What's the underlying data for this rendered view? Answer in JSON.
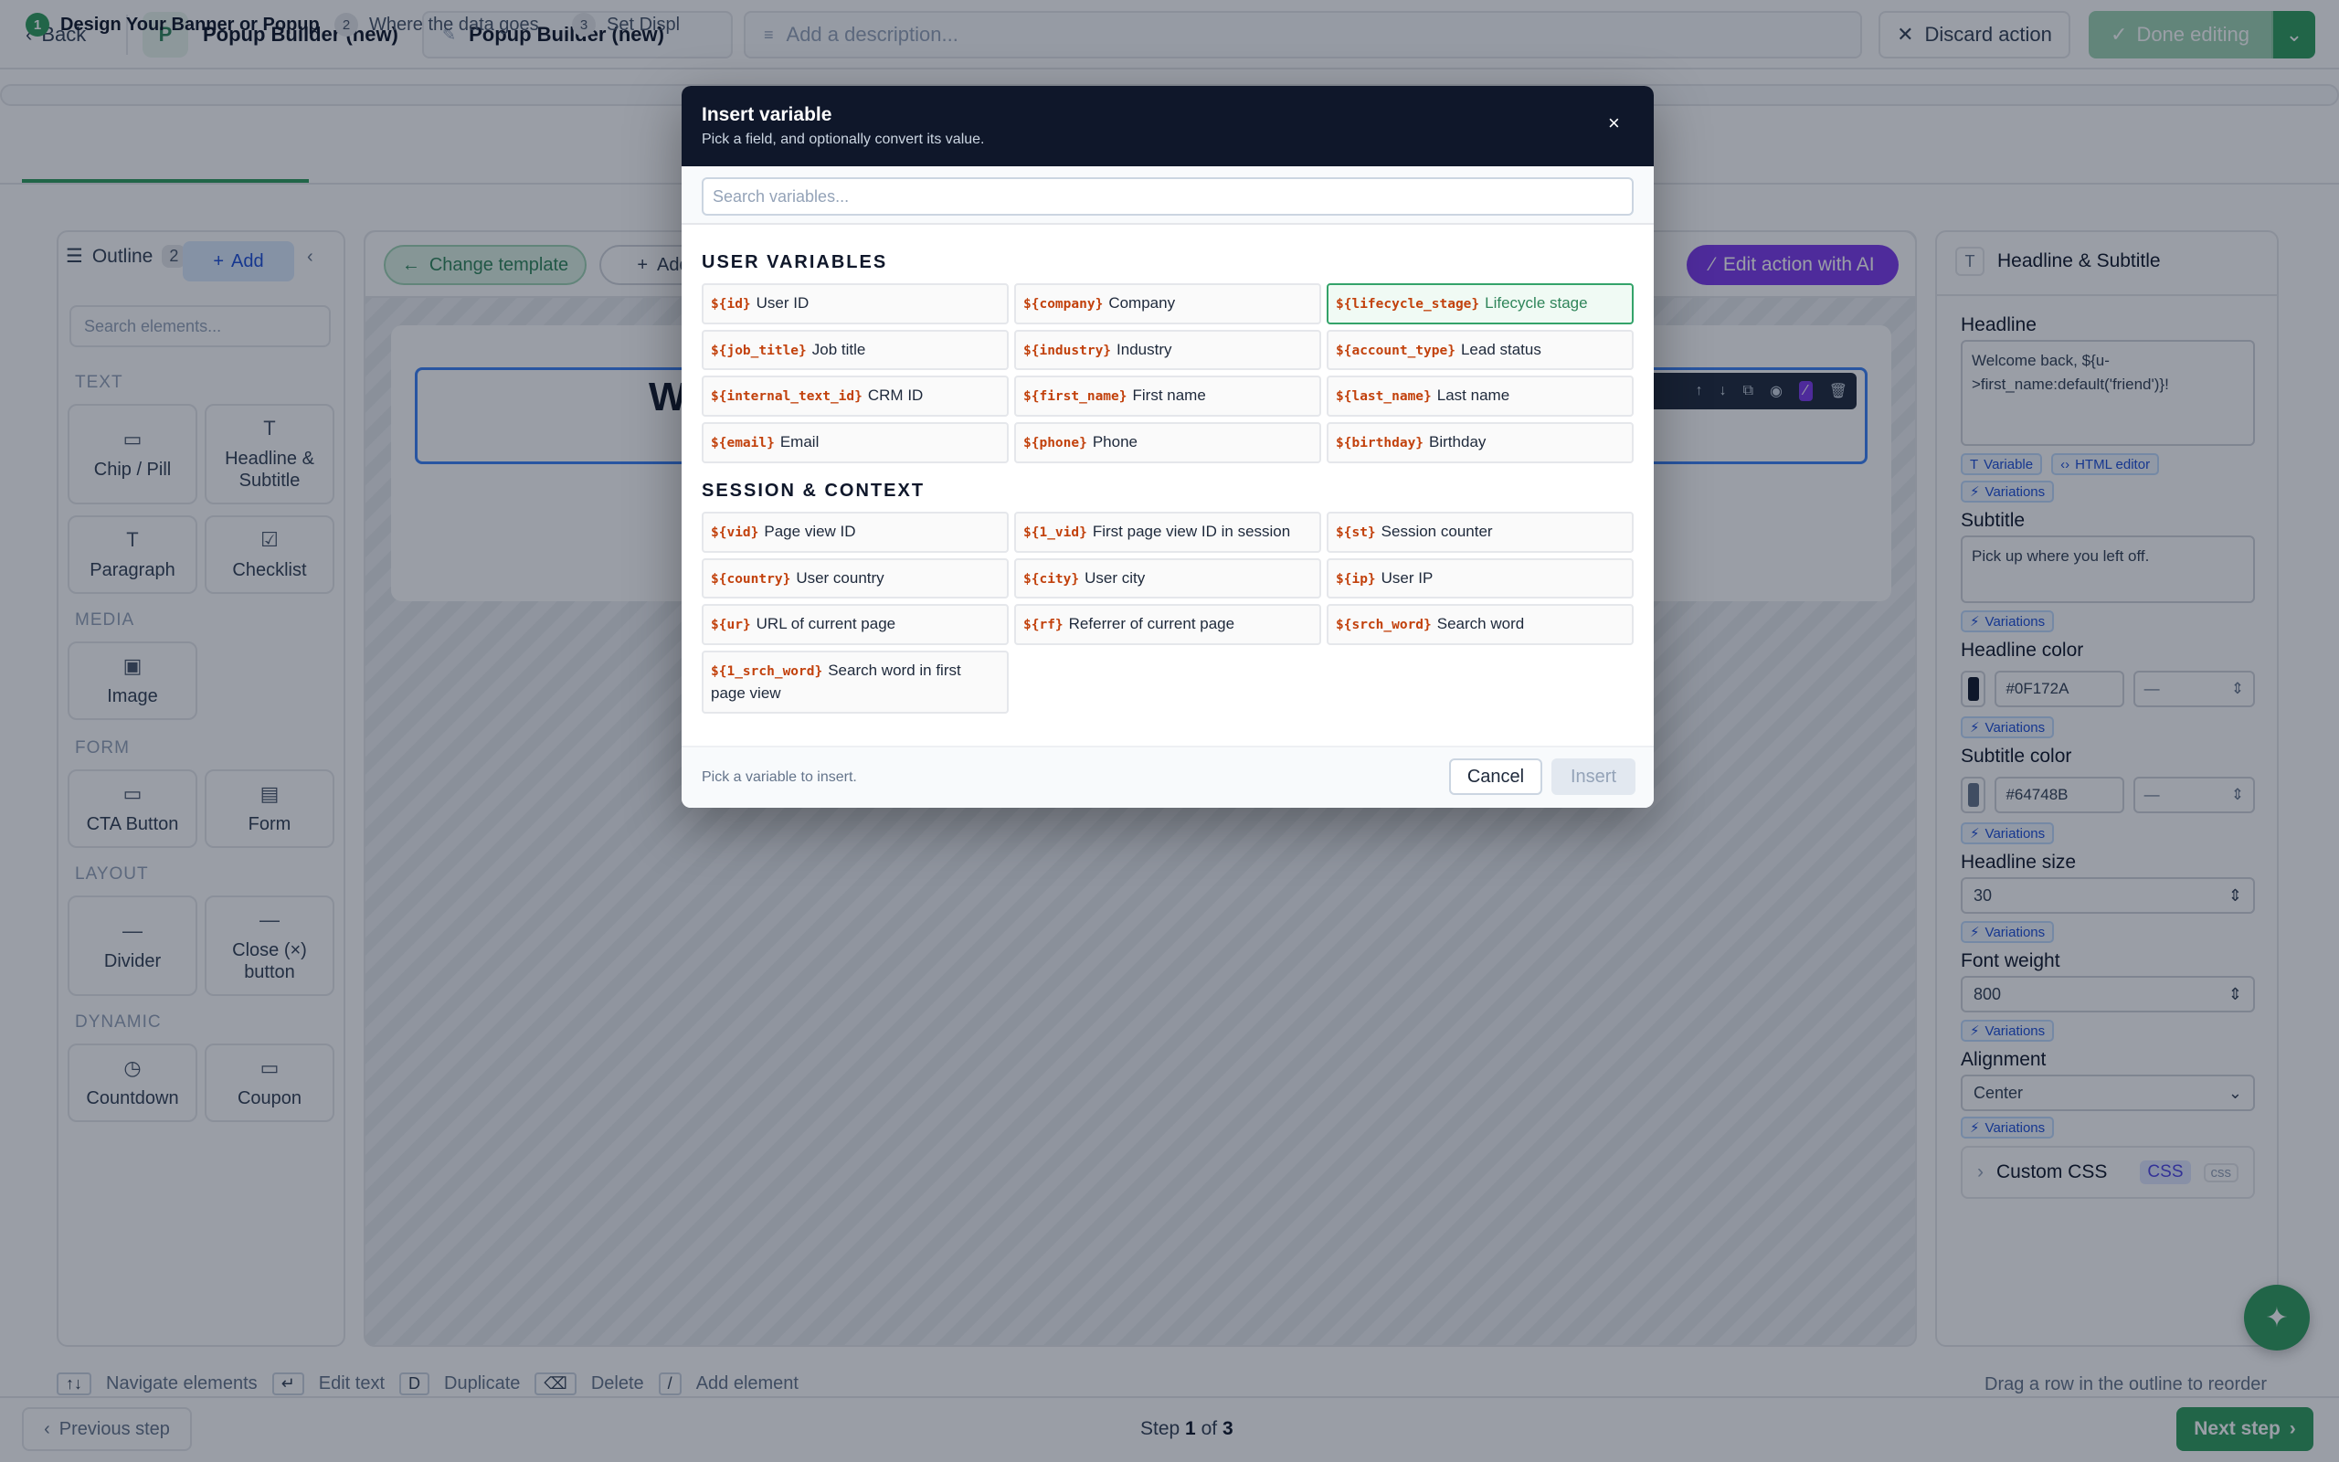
{
  "topbar": {
    "back_label": "Back",
    "app_avatar": "P",
    "app_name": "Popup Builder (new)",
    "title_value": "Popup Builder (new)",
    "description_placeholder": "Add a description...",
    "discard_label": "Discard action",
    "done_label": "Done editing"
  },
  "stepper": {
    "steps": [
      {
        "num": "1",
        "label": "Design Your Banner or Popup"
      },
      {
        "num": "2",
        "label": "Where the data goes"
      },
      {
        "num": "3",
        "label": "Set Displ"
      }
    ]
  },
  "outline": {
    "title": "Outline",
    "count": "2",
    "add_label": "Add",
    "search_placeholder": "Search elements...",
    "sections": [
      {
        "title": "TEXT",
        "tiles": [
          "Chip / Pill",
          "Headline & Subtitle",
          "Paragraph",
          "Checklist"
        ]
      },
      {
        "title": "MEDIA",
        "tiles": [
          "Image"
        ]
      },
      {
        "title": "FORM",
        "tiles": [
          "CTA Button",
          "Form"
        ]
      },
      {
        "title": "LAYOUT",
        "tiles": [
          "Divider",
          "Close (×) button"
        ]
      },
      {
        "title": "DYNAMIC",
        "tiles": [
          "Countdown",
          "Coupon"
        ]
      }
    ]
  },
  "canvas": {
    "change_template_label": "Change template",
    "add_label": "Add",
    "edit_ai_label": "Edit action with AI",
    "headline_preview": "W"
  },
  "props": {
    "title": "Headline & Subtitle",
    "headline_label": "Headline",
    "headline_value": "Welcome back, ${u->first_name:default('friend')}!",
    "variable_chip": "Variable",
    "html_editor_chip": "HTML editor",
    "variations_label": "Variations",
    "subtitle_label": "Subtitle",
    "subtitle_value": "Pick up where you left off.",
    "headline_color_label": "Headline color",
    "headline_color_hex": "#0F172A",
    "subtitle_color_label": "Subtitle color",
    "subtitle_color_hex": "#64748B",
    "unit_placeholder": "—",
    "headline_size_label": "Headline size",
    "headline_size_value": "30",
    "font_weight_label": "Font weight",
    "font_weight_value": "800",
    "alignment_label": "Alignment",
    "alignment_value": "Center",
    "custom_css_label": "Custom CSS",
    "css_pill": "CSS",
    "css_pill_small": "css"
  },
  "colors": {
    "brand_green": "#2f9e5e",
    "ai_purple": "#7c3aed",
    "modal_header": "#0f172a",
    "token_orange": "#c2410c"
  },
  "hints": {
    "items": [
      {
        "key": "↑↓",
        "label": "Navigate elements"
      },
      {
        "key": "↵",
        "label": "Edit text"
      },
      {
        "key": "D",
        "label": "Duplicate"
      },
      {
        "key": "⌫",
        "label": "Delete"
      },
      {
        "key": "/",
        "label": "Add element"
      }
    ],
    "right": "Drag a row in the outline to reorder"
  },
  "footer": {
    "prev_label": "Previous step",
    "step_prefix": "Step",
    "step_current": "1",
    "step_of": "of",
    "step_total": "3",
    "next_label": "Next step"
  },
  "modal": {
    "title": "Insert variable",
    "subtitle": "Pick a field, and optionally convert its value.",
    "search_placeholder": "Search variables...",
    "sections": [
      {
        "title": "USER VARIABLES",
        "vars": [
          {
            "token": "${id}",
            "label": "User ID"
          },
          {
            "token": "${company}",
            "label": "Company"
          },
          {
            "token": "${lifecycle_stage}",
            "label": "Lifecycle stage",
            "selected": true
          },
          {
            "token": "${job_title}",
            "label": "Job title"
          },
          {
            "token": "${industry}",
            "label": "Industry"
          },
          {
            "token": "${account_type}",
            "label": "Lead status"
          },
          {
            "token": "${internal_text_id}",
            "label": "CRM ID"
          },
          {
            "token": "${first_name}",
            "label": "First name"
          },
          {
            "token": "${last_name}",
            "label": "Last name"
          },
          {
            "token": "${email}",
            "label": "Email"
          },
          {
            "token": "${phone}",
            "label": "Phone"
          },
          {
            "token": "${birthday}",
            "label": "Birthday"
          }
        ]
      },
      {
        "title": "SESSION & CONTEXT",
        "vars": [
          {
            "token": "${vid}",
            "label": "Page view ID"
          },
          {
            "token": "${1_vid}",
            "label": "First page view ID in session"
          },
          {
            "token": "${st}",
            "label": "Session counter"
          },
          {
            "token": "${country}",
            "label": "User country"
          },
          {
            "token": "${city}",
            "label": "User city"
          },
          {
            "token": "${ip}",
            "label": "User IP"
          },
          {
            "token": "${ur}",
            "label": "URL of current page"
          },
          {
            "token": "${rf}",
            "label": "Referrer of current page"
          },
          {
            "token": "${srch_word}",
            "label": "Search word"
          },
          {
            "token": "${1_srch_word}",
            "label": "Search word in first page view"
          }
        ]
      }
    ],
    "footer_hint": "Pick a variable to insert.",
    "cancel_label": "Cancel",
    "insert_label": "Insert"
  }
}
